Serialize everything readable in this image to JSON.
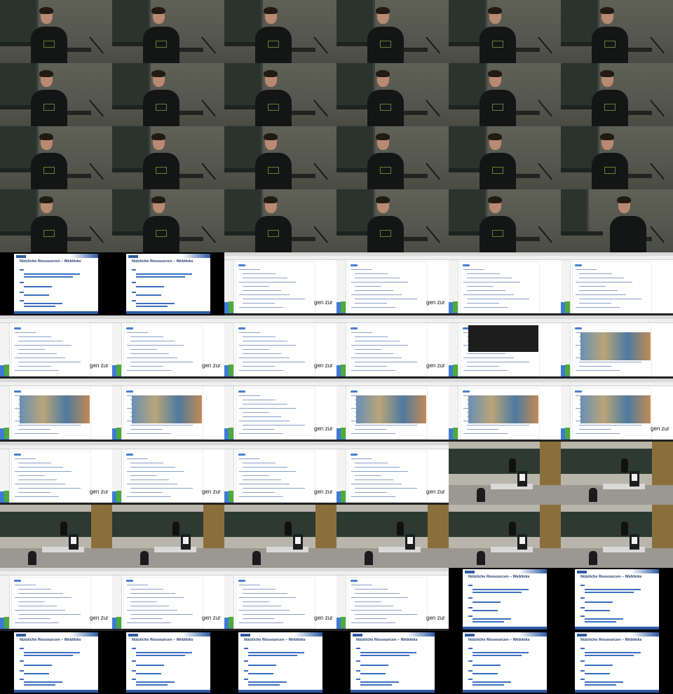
{
  "slide": {
    "title": "Nützliche Ressourcen – Weblinks"
  },
  "overlay": {
    "fragment": "gen zur"
  },
  "tiles": [
    "speaker",
    "speaker",
    "speaker",
    "speaker",
    "speaker",
    "speaker",
    "speaker",
    "speaker",
    "speaker",
    "speaker",
    "speaker",
    "speaker",
    "speaker",
    "speaker",
    "speaker",
    "speaker",
    "speaker",
    "speaker",
    "speaker",
    "speaker",
    "speaker",
    "speaker",
    "speaker",
    "speaker-alt",
    "slide",
    "slide",
    "browser-list",
    "browser-list",
    "browser-doc",
    "browser-doc",
    "browser-doc",
    "browser-doc",
    "browser-doc",
    "browser-doc",
    "browser-dark",
    "browser-map",
    "browser-map",
    "browser-map",
    "browser-doc",
    "browser-map",
    "browser-map",
    "browser-map",
    "browser-doc",
    "browser-doc",
    "browser-doc",
    "browser-doc",
    "hall",
    "hall",
    "hall",
    "hall",
    "hall",
    "hall",
    "hall",
    "hall",
    "browser-doc",
    "browser-doc",
    "browser-list",
    "browser-list",
    "slide",
    "slide",
    "slide",
    "slide",
    "slide",
    "slide",
    "slide",
    "slide"
  ]
}
